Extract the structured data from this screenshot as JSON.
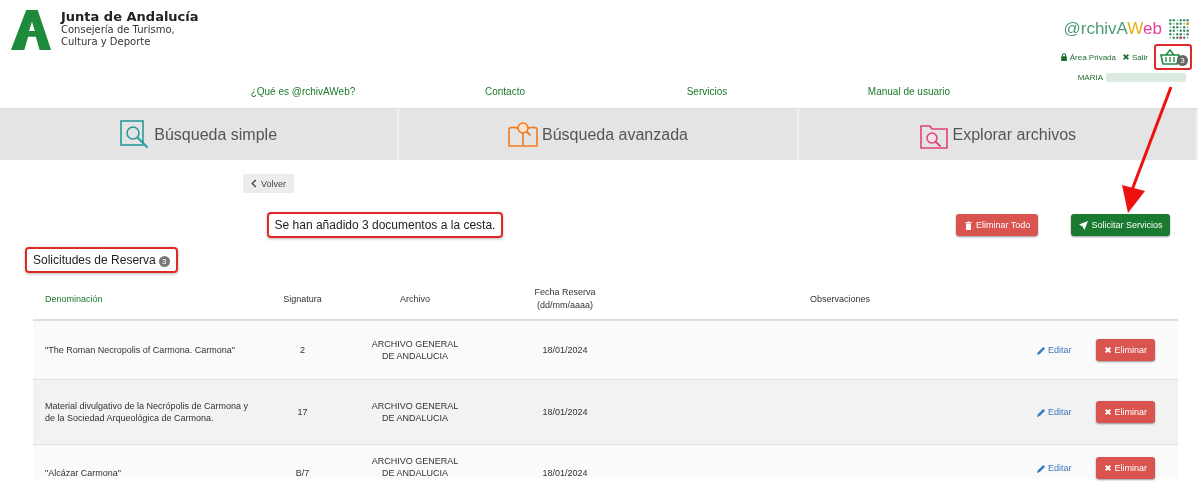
{
  "header": {
    "org_name": "Junta de Andalucía",
    "org_dept": [
      "Consejería de Turismo,",
      "Cultura y Deporte"
    ],
    "brand": [
      {
        "text": "@rchivA",
        "color": "#4f9a78"
      },
      {
        "text": "W",
        "color": "#e8b010"
      },
      {
        "text": "eb",
        "color": "#e8409a"
      }
    ],
    "user_links": [
      {
        "kind": "lock",
        "label": "Área Privada"
      },
      {
        "kind": "close",
        "label": "Salir"
      }
    ],
    "basket_count": "3",
    "user_name": "MARIA"
  },
  "nav": [
    "¿Qué es @rchivAWeb?",
    "Contacto",
    "Servicios",
    "Manual de usuario"
  ],
  "tabs": [
    {
      "kind": "search",
      "label": "Búsqueda simple",
      "selected": false
    },
    {
      "kind": "book",
      "label": "Búsqueda avanzada",
      "selected": false
    },
    {
      "kind": "folder",
      "label": "Explorar archivos",
      "selected": false
    }
  ],
  "back_button": "Volver",
  "message": "Se han añadido 3 documentos a la cesta.",
  "actions": [
    {
      "kind": "danger",
      "label": "Eliminar Todo"
    },
    {
      "kind": "primary",
      "label": "Solicitar Servicios"
    }
  ],
  "section": {
    "title": "Solicitudes de Reserva",
    "count": "3"
  },
  "table": {
    "columns": [
      {
        "lines": [
          "Denominación"
        ],
        "sorted": true
      },
      {
        "lines": [
          "Signatura"
        ],
        "sorted": false
      },
      {
        "lines": [
          "Archivo"
        ],
        "sorted": false
      },
      {
        "lines": [
          "Fecha Reserva",
          "(dd/mm/aaaa)"
        ],
        "sorted": false
      },
      {
        "lines": [
          "Observaciones"
        ],
        "sorted": false
      }
    ],
    "rows": [
      {
        "denominacion": "\"The Roman Necropolis of Carmona. Carmona\"",
        "signatura": "2",
        "archivo": "ARCHIVO GENERAL DE ANDALUCIA",
        "fecha": "18/01/2024",
        "edit": "Editar",
        "delete": "Eliminar"
      },
      {
        "denominacion": "Material divulgativo de la Necrópolis de Carmona y de la Sociedad Arqueológica de Carmona.",
        "signatura": "17",
        "archivo": "ARCHIVO GENERAL DE ANDALUCIA",
        "fecha": "18/01/2024",
        "edit": "Editar",
        "delete": "Eliminar"
      },
      {
        "denominacion": "\"Alcázar Carmona\"",
        "signatura": "B/7",
        "archivo": "ARCHIVO GENERAL DE ANDALUCIA",
        "fecha": "18/01/2024",
        "edit": "Editar",
        "delete": "Eliminar"
      }
    ]
  }
}
